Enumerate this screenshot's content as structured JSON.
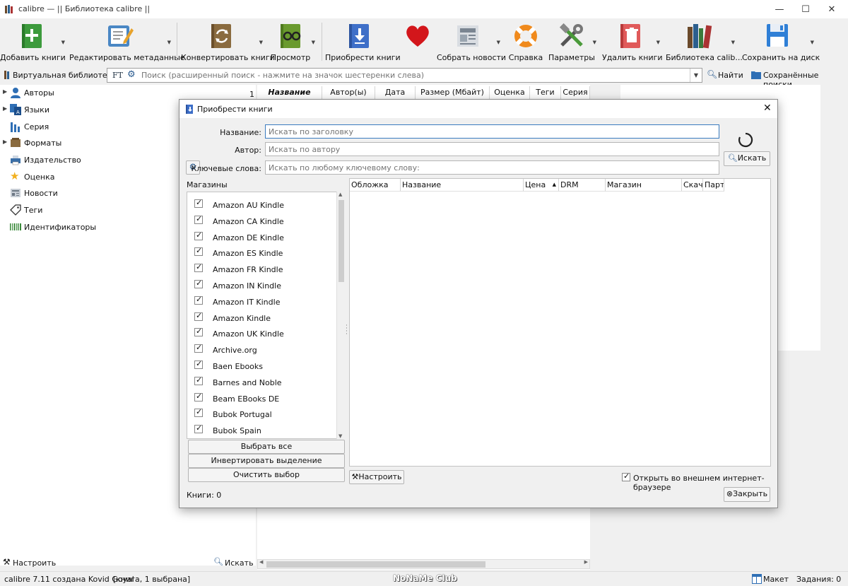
{
  "window": {
    "title": "calibre — || Библиотека calibre ||",
    "minimize": "—",
    "maximize": "☐",
    "close": "✕"
  },
  "toolbar": {
    "items": [
      {
        "label": "Добавить книги",
        "icon": "add-books-icon",
        "dropdown": true
      },
      {
        "label": "Редактировать метаданные",
        "icon": "edit-metadata-icon",
        "dropdown": true
      },
      {
        "label": "Конвертировать книги",
        "icon": "convert-books-icon",
        "dropdown": true
      },
      {
        "label": "Просмотр",
        "icon": "view-book-icon",
        "dropdown": true
      },
      {
        "label": "Приобрести книги",
        "icon": "get-books-icon",
        "dropdown": false
      },
      {
        "label": "",
        "icon": "heart-icon",
        "dropdown": false
      },
      {
        "label": "Собрать новости",
        "icon": "fetch-news-icon",
        "dropdown": true
      },
      {
        "label": "Справка",
        "icon": "help-lifebuoy-icon",
        "dropdown": false
      },
      {
        "label": "Параметры",
        "icon": "preferences-tools-icon",
        "dropdown": true
      },
      {
        "label": "Удалить книги",
        "icon": "remove-books-icon",
        "dropdown": true
      },
      {
        "label": "Библиотека calib...",
        "icon": "library-icon",
        "dropdown": true
      },
      {
        "label": "Сохранить на диск",
        "icon": "save-disk-icon",
        "dropdown": true
      }
    ]
  },
  "search": {
    "virtual_library": "Виртуальная библиотека",
    "ft": "FT",
    "placeholder": "Поиск (расширенный поиск - нажмите на значок шестеренки слева)",
    "find_button": "Найти",
    "saved_searches": "Сохранённые поиски"
  },
  "sidebar": {
    "categories": [
      {
        "label": "Авторы",
        "icon": "authors-icon",
        "expandable": true
      },
      {
        "label": "Языки",
        "icon": "languages-icon",
        "expandable": true
      },
      {
        "label": "Серия",
        "icon": "series-icon",
        "expandable": false
      },
      {
        "label": "Форматы",
        "icon": "formats-icon",
        "expandable": true
      },
      {
        "label": "Издательство",
        "icon": "publisher-icon",
        "expandable": false
      },
      {
        "label": "Оценка",
        "icon": "rating-star-icon",
        "expandable": false
      },
      {
        "label": "Новости",
        "icon": "news-icon",
        "expandable": false
      },
      {
        "label": "Теги",
        "icon": "tags-icon",
        "expandable": false
      },
      {
        "label": "Идентификаторы",
        "icon": "identifiers-barcode-icon",
        "expandable": false
      }
    ],
    "configure": "Настроить",
    "find": "Искать"
  },
  "book_table": {
    "row_number": "1",
    "columns": [
      "Название",
      "Автор(ы)",
      "Дата",
      "Размер (Мбайт)",
      "Оценка",
      "Теги",
      "Серия"
    ]
  },
  "status": {
    "left": "calibre 7.11 создана Kovid Goyal",
    "selection": "[книга, 1 выбрана]",
    "watermark": "NoNaMe Club",
    "layout": "Макет",
    "jobs": "Задания: 0"
  },
  "dialog": {
    "title": "Приобрести книги",
    "close": "✕",
    "title_label": "Название:",
    "title_placeholder": "Искать по заголовку",
    "author_label": "Автор:",
    "author_placeholder": "Искать по автору",
    "keywords_label": "Ключевые слова:",
    "keywords_placeholder": "Искать по любому ключевому слову:",
    "search_button": "Искать",
    "stores_label": "Магазины",
    "stores": [
      "Amazon AU Kindle",
      "Amazon CA Kindle",
      "Amazon DE Kindle",
      "Amazon ES Kindle",
      "Amazon FR Kindle",
      "Amazon IN Kindle",
      "Amazon IT Kindle",
      "Amazon Kindle",
      "Amazon UK Kindle",
      "Archive.org",
      "Baen Ebooks",
      "Barnes and Noble",
      "Beam EBooks DE",
      "Bubok Portugal",
      "Bubok Spain"
    ],
    "select_all": "Выбрать все",
    "invert_selection": "Инвертировать выделение",
    "clear_selection": "Очистить выбор",
    "result_columns": [
      "Обложка",
      "Название",
      "Цена",
      "DRM",
      "Магазин",
      "Скача",
      "Партн"
    ],
    "configure": "Настроить",
    "open_external": "Открыть во внешнем интернет-браузере",
    "books_count": "Книги:  0",
    "close_button": "Закрыть"
  }
}
